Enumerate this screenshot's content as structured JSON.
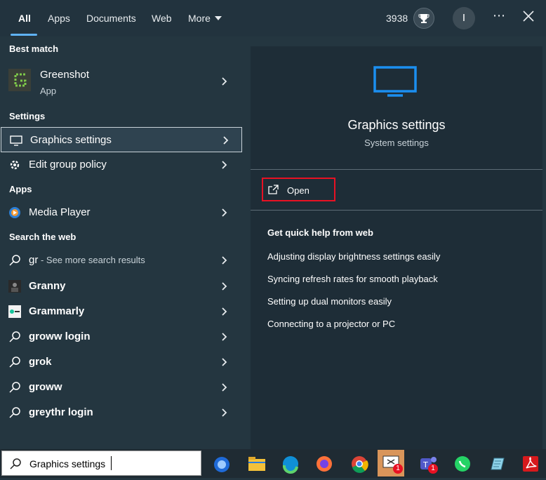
{
  "tabs": {
    "all": "All",
    "apps": "Apps",
    "documents": "Documents",
    "web": "Web",
    "more": "More"
  },
  "header": {
    "points": "3938",
    "avatar_letter": "I",
    "more_dots": "⋯"
  },
  "left": {
    "best_match_heading": "Best match",
    "best_match": {
      "name": "Greenshot",
      "type": "App"
    },
    "settings_heading": "Settings",
    "settings": [
      {
        "label": "Graphics settings"
      },
      {
        "label": "Edit group policy"
      }
    ],
    "apps_heading": "Apps",
    "apps": [
      {
        "label": "Media Player"
      }
    ],
    "web_heading": "Search the web",
    "web_first": {
      "query": "gr",
      "suffix": " - See more search results"
    },
    "web": [
      {
        "label": "Granny"
      },
      {
        "label": "Grammarly"
      },
      {
        "label": "groww login"
      },
      {
        "label": "grok"
      },
      {
        "label": "groww"
      },
      {
        "label": "greythr login"
      }
    ]
  },
  "right": {
    "title": "Graphics settings",
    "subtitle": "System settings",
    "open_label": "Open",
    "help_heading": "Get quick help from web",
    "help_links": [
      "Adjusting display brightness settings easily",
      "Syncing refresh rates for smooth playback",
      "Setting up dual monitors easily",
      "Connecting to a projector or PC"
    ]
  },
  "search": {
    "value": "Graphics settings"
  },
  "taskbar": {
    "teams_badge": "1",
    "snip_badge": "1"
  },
  "colors": {
    "accent": "#5fb2f5",
    "highlight": "#e81123",
    "greenshot": "#7ec94a"
  }
}
